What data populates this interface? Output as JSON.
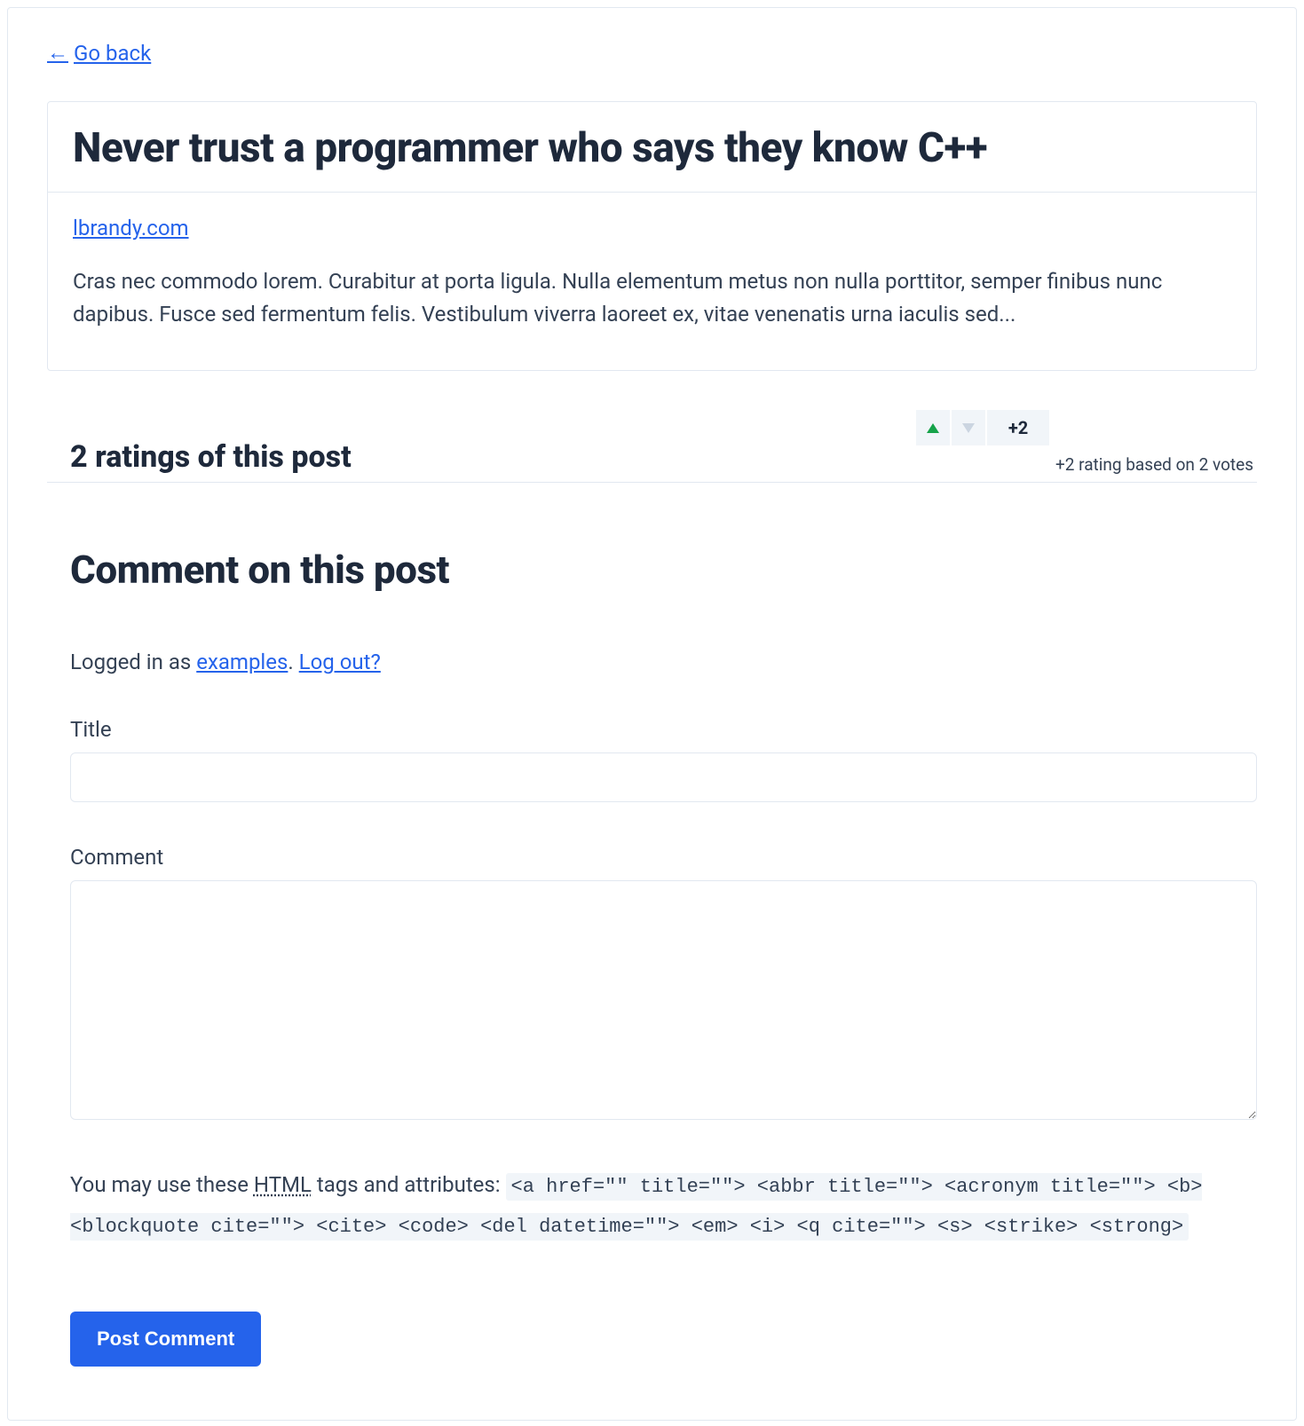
{
  "nav": {
    "go_back": "Go back",
    "arrow": "←"
  },
  "post": {
    "title": "Never trust a programmer who says they know C++",
    "source_label": "lbrandy.com",
    "excerpt": "Cras nec commodo lorem. Curabitur at porta ligula. Nulla elementum metus non nulla porttitor, semper finibus nunc dapibus. Fusce sed fermentum felis. Vestibulum viverra laoreet ex, vitae venenatis urna iaculis sed..."
  },
  "ratings": {
    "heading": "2 ratings of this post",
    "score_display": "+2",
    "summary": "+2 rating based on 2 votes"
  },
  "comment_form": {
    "heading": "Comment on this post",
    "logged_prefix": "Logged in as ",
    "username": "examples",
    "logged_sep": ". ",
    "logout_label": "Log out?",
    "title_label": "Title",
    "title_value": "",
    "comment_label": "Comment",
    "comment_value": "",
    "allowed_prefix": "You may use these ",
    "allowed_abbr": "HTML",
    "allowed_suffix": " tags and attributes:  ",
    "allowed_tags_code": "<a href=\"\" title=\"\"> <abbr title=\"\"> <acronym title=\"\"> <b> <blockquote cite=\"\"> <cite> <code> <del datetime=\"\"> <em> <i> <q cite=\"\"> <s> <strike> <strong>",
    "submit_label": "Post Comment"
  }
}
